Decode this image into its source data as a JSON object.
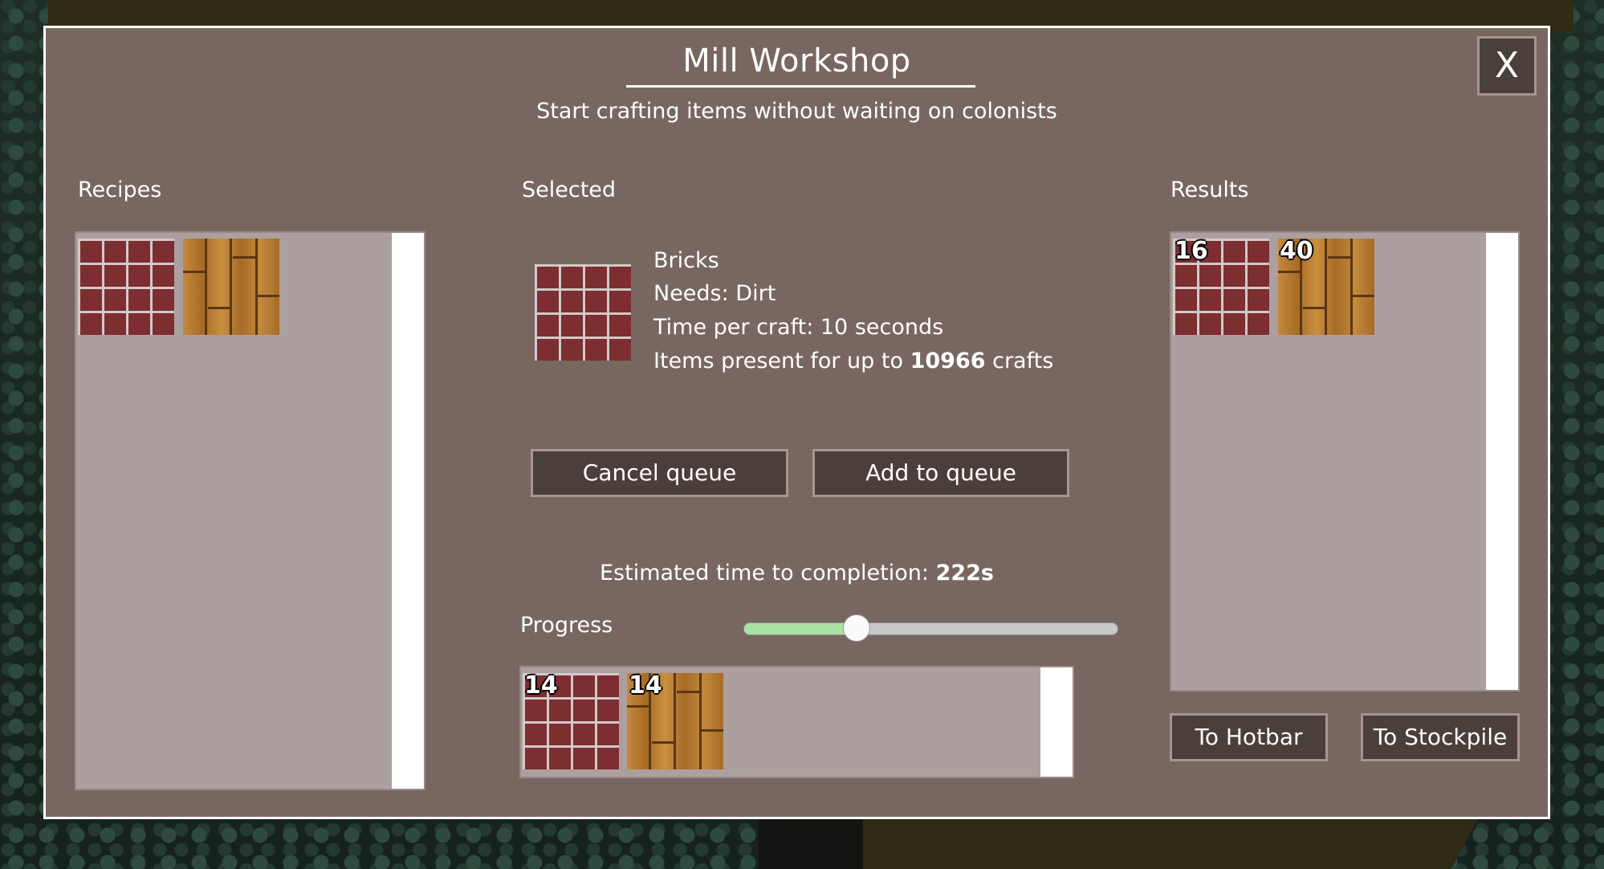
{
  "window": {
    "title": "Mill Workshop",
    "subtitle": "Start crafting items without waiting on colonists",
    "close_label": "X"
  },
  "recipes": {
    "label": "Recipes",
    "items": [
      {
        "icon": "brick-icon"
      },
      {
        "icon": "wood-plank-icon"
      }
    ]
  },
  "selected": {
    "label": "Selected",
    "icon": "brick-icon",
    "name": "Bricks",
    "needs": "Needs: Dirt",
    "time_per_craft": "Time per craft: 10 seconds",
    "items_present_prefix": "Items present for up to",
    "items_present_count": "10966",
    "items_present_suffix": "crafts"
  },
  "buttons": {
    "cancel_queue": "Cancel queue",
    "add_to_queue": "Add to queue",
    "to_hotbar": "To Hotbar",
    "to_stockpile": "To Stockpile"
  },
  "estimate": {
    "prefix": "Estimated time to completion:",
    "value": "222s"
  },
  "progress": {
    "label": "Progress",
    "value": 0.3,
    "fill_color": "#a9e2a4"
  },
  "queue": {
    "items": [
      {
        "icon": "brick-icon",
        "count": "14"
      },
      {
        "icon": "wood-plank-icon",
        "count": "14"
      }
    ]
  },
  "results": {
    "label": "Results",
    "items": [
      {
        "icon": "brick-icon",
        "count": "16"
      },
      {
        "icon": "wood-plank-icon",
        "count": "40"
      }
    ]
  },
  "colors": {
    "dialog_bg": "#786760",
    "button_bg": "#4b3f3c",
    "panel_bg": "#aba09f"
  }
}
